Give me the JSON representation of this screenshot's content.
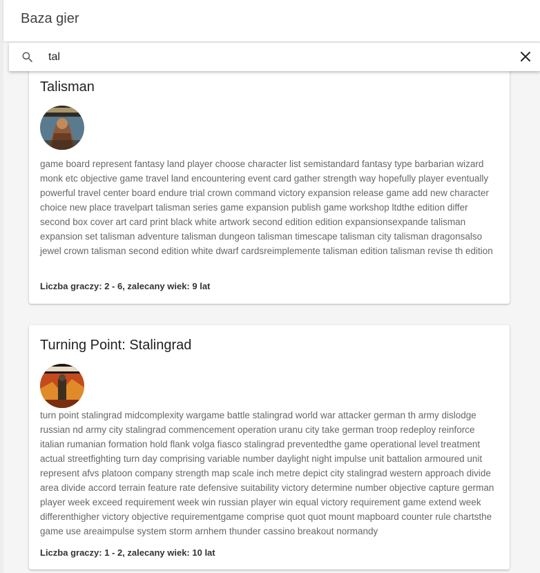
{
  "appbar": {
    "title": "Baza gier"
  },
  "search": {
    "value": "tal",
    "icon": "search-icon",
    "clear_icon": "close-icon"
  },
  "games": [
    {
      "title": "Talisman",
      "description": "game board represent fantasy land player choose character list semistandard fantasy type barbarian wizard monk etc objective game travel land encountering event card gather strength way hopefully player eventually powerful travel center board endure trial crown command victory expansion release game add new character choice new place travelpart talisman series game expansion publish game workshop ltdthe edition differ second box cover art card print black white artwork second edition edition expansionsexpande talisman expansion set talisman adventure talisman dungeon talisman timescape talisman city talisman dragonsalso jewel crown talisman second edition white dwarf cardsreimplemente talisman edition talisman revise th edition",
      "meta": "Liczba graczy: 2 - 6, zalecany wiek: 9 lat"
    },
    {
      "title": "Turning Point: Stalingrad",
      "description": "turn point stalingrad midcomplexity wargame battle stalingrad world war attacker german th army dislodge russian nd army city stalingrad commencement operation uranu city take german troop redeploy reinforce italian rumanian formation hold flank volga fiasco stalingrad preventedthe game operational level treatment actual streetfighting turn day comprising variable number daylight night impulse unit battalion armoured unit represent afvs platoon company strength map scale inch metre depict city stalingrad western approach divide area divide accord terrain feature rate defensive suitability victory determine number objective capture german player week exceed requirement week win russian player win equal victory requirement game extend week differenthigher victory objective requirementgame comprise quot quot mount mapboard counter rule chartsthe game use areaimpulse system storm arnhem thunder cassino breakout normandy",
      "meta": "Liczba graczy: 1 - 2, zalecany wiek: 10 lat"
    }
  ]
}
